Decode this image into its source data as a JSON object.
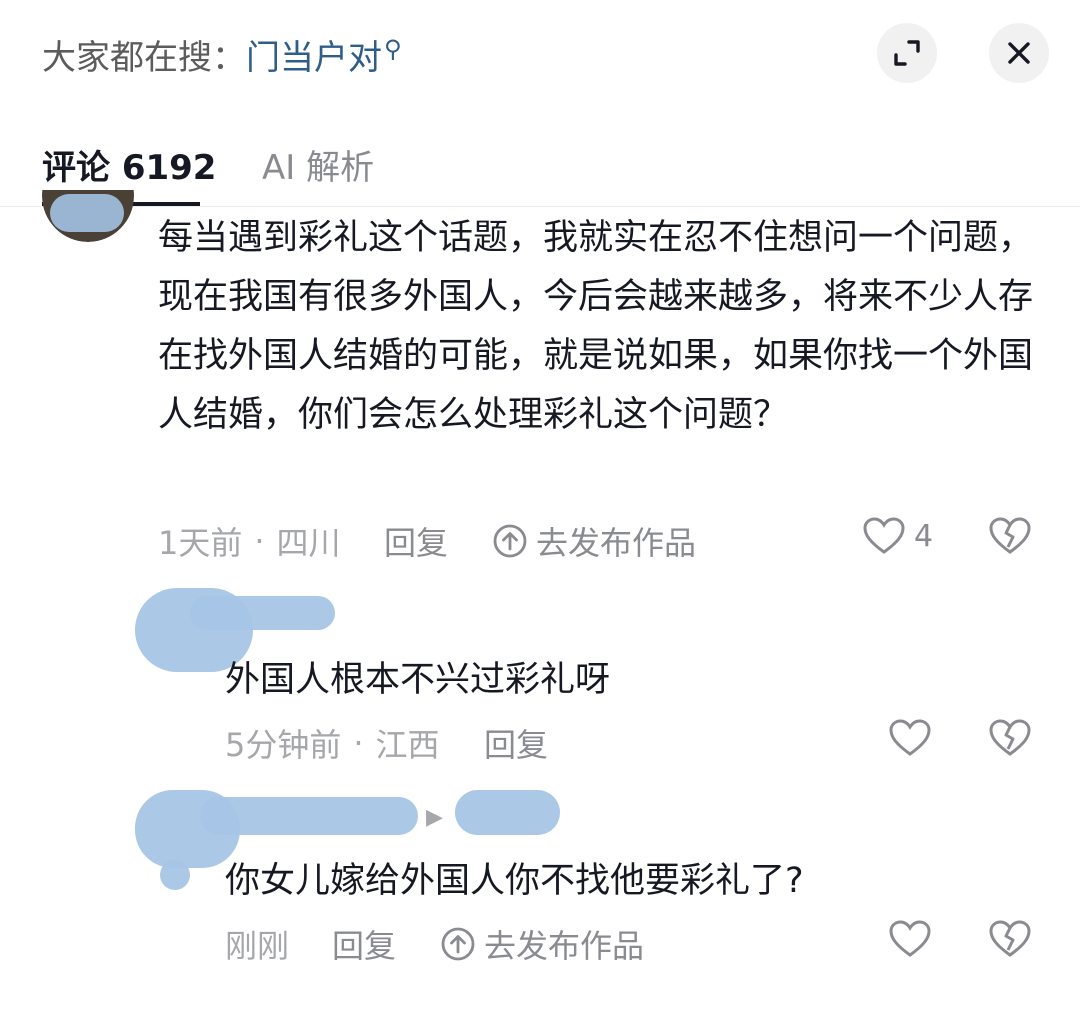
{
  "header": {
    "search_prefix": "大家都在搜：",
    "search_term": "门当户对",
    "search_icon": "search-icon",
    "expand_icon": "expand-icon",
    "close_icon": "close-icon"
  },
  "tabs": [
    {
      "label": "评论 6192",
      "active": true
    },
    {
      "label": "AI 解析",
      "active": false
    }
  ],
  "colors": {
    "search_term": "#2f5d8a",
    "meta_text": "#a6a7ab",
    "action_text": "#8a8b91",
    "primary_text": "#161823",
    "blur_mask": "#a7c5e6"
  },
  "comments": [
    {
      "text": "每当遇到彩礼这个话题，我就实在忍不住想问一个问题，现在我国有很多外国人，今后会越来越多，将来不少人存在找外国人结婚的可能，就是说如果，如果你找一个外国人结婚，你们会怎么处理彩礼这个问题？",
      "time": "1天前",
      "location": "四川",
      "reply_label": "回复",
      "publish_label": "去发布作品",
      "like_count": "4"
    },
    {
      "text": "外国人根本不兴过彩礼呀",
      "time": "5分钟前",
      "location": "江西",
      "reply_label": "回复"
    },
    {
      "text": "你女儿嫁给外国人你不找他要彩礼了?",
      "time": "刚刚",
      "reply_label": "回复",
      "publish_label": "去发布作品"
    }
  ]
}
